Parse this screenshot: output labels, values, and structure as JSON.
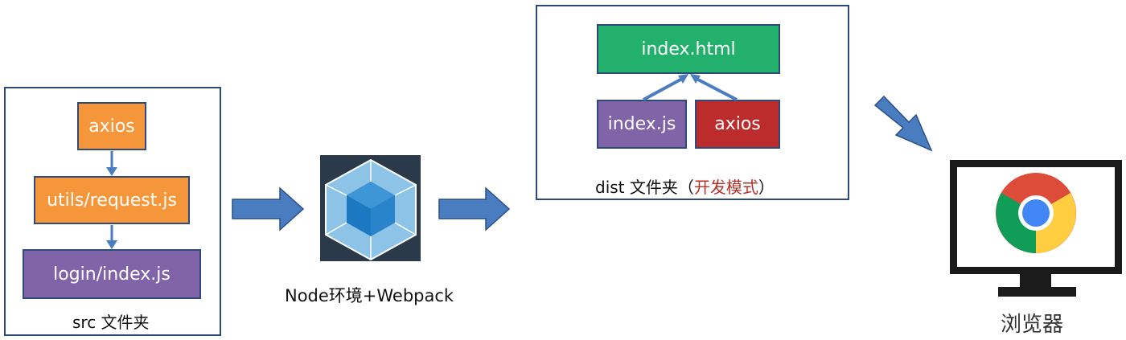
{
  "src": {
    "box1": "axios",
    "box2": "utils/request.js",
    "box3": "login/index.js",
    "caption": "src 文件夹"
  },
  "webpack": {
    "caption": "Node环境+Webpack"
  },
  "dist": {
    "top": "index.html",
    "left": "index.js",
    "right": "axios",
    "caption_prefix": "dist 文件夹（",
    "caption_mode": "开发模式",
    "caption_suffix": "）"
  },
  "browser": {
    "caption": "浏览器"
  },
  "colors": {
    "orange": "#f5963a",
    "purple": "#8163a7",
    "green": "#23b06c",
    "red": "#bd2c2c",
    "arrow_blue": "#4a7cc0",
    "mode_text": "#b5322a"
  }
}
